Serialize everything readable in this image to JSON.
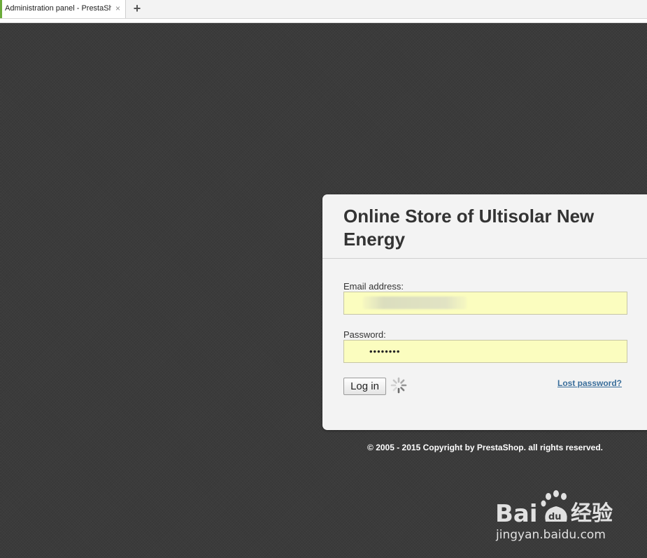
{
  "browser": {
    "tab_title": "Administration panel - PrestaShop",
    "tab_close_glyph": "×",
    "new_tab_glyph": "+"
  },
  "login": {
    "shop_name": "Online Store of Ultisolar New Energy",
    "email_label": "Email address:",
    "email_value": "",
    "password_label": "Password:",
    "password_value": "••••••••",
    "login_button": "Log in",
    "lost_password_link": "Lost password?",
    "loading_icon": "spinner-icon"
  },
  "footer": {
    "copyright": "© 2005 - 2015 Copyright by PrestaShop. all rights reserved."
  },
  "watermark": {
    "logo_text": "Baidu经验",
    "url": "jingyan.baidu.com"
  },
  "colors": {
    "background": "#3b3b3b",
    "panel": "#f3f3f3",
    "input_autofill": "#fbfdbf",
    "link": "#3a6e9b",
    "tab_accent": "#6bab3a"
  }
}
